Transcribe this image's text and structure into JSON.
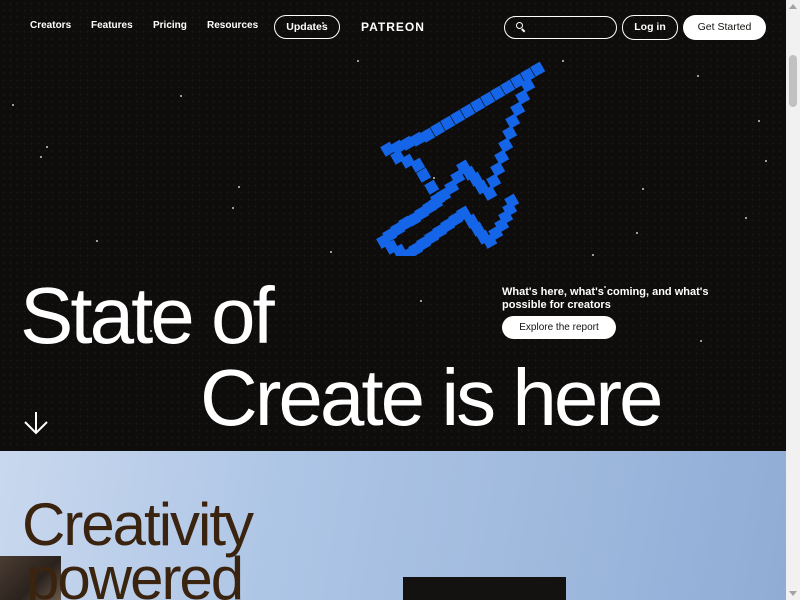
{
  "nav": {
    "links": [
      "Creators",
      "Features",
      "Pricing",
      "Resources"
    ],
    "updates_label": "Updates",
    "logo": "PATREON",
    "search_placeholder": "",
    "login_label": "Log in",
    "get_started_label": "Get Started"
  },
  "hero": {
    "headline_line1": "State of",
    "headline_line2": "Create is here",
    "tagline": "What's here, what's coming, and what's possible for creators",
    "cta_label": "Explore the report",
    "accent_color": "#1565e8"
  },
  "section2": {
    "headline_line1": "Creativity",
    "headline_line2": "powered"
  },
  "icons": [
    "search-icon",
    "pixel-cursor-icon",
    "arrow-down-icon"
  ]
}
